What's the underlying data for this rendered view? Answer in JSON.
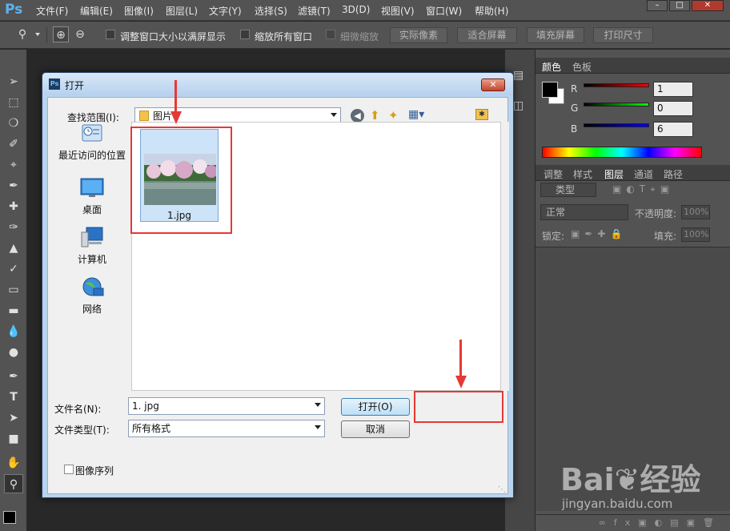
{
  "menubar": {
    "logo": "Ps",
    "items": [
      "文件(F)",
      "编辑(E)",
      "图像(I)",
      "图层(L)",
      "文字(Y)",
      "选择(S)",
      "滤镜(T)",
      "3D(D)",
      "视图(V)",
      "窗口(W)",
      "帮助(H)"
    ],
    "win_min": "–",
    "win_max": "□",
    "win_close": "✕"
  },
  "optionsbar": {
    "resize_windows": "调整窗口大小以满屏显示",
    "zoom_all": "缩放所有窗口",
    "scrubby_zoom": "细微缩放",
    "actual_pixels": "实际像素",
    "fit_screen": "适合屏幕",
    "fill_screen": "填充屏幕",
    "print_size": "打印尺寸"
  },
  "color_panel": {
    "tabs": [
      "颜色",
      "色板"
    ],
    "labels": [
      "R",
      "G",
      "B"
    ],
    "values": [
      "1",
      "0",
      "6"
    ],
    "foreground": "#010006",
    "background": "#ffffff"
  },
  "layers_panel": {
    "tabs": [
      "调整",
      "样式",
      "图层",
      "通道",
      "路径"
    ],
    "filter_kind": "类型",
    "blend_mode": "正常",
    "opacity_label": "不透明度:",
    "opacity_value": "100%",
    "lock_label": "锁定:",
    "fill_label": "填充:",
    "fill_value": "100%"
  },
  "dialog": {
    "title": "打开",
    "look_in_label": "查找范围(I):",
    "look_in_value": "图片",
    "places": [
      {
        "label": "最近访问的位置",
        "icon": "recent-places-icon"
      },
      {
        "label": "桌面",
        "icon": "desktop-icon"
      },
      {
        "label": "计算机",
        "icon": "computer-icon"
      },
      {
        "label": "网络",
        "icon": "network-icon"
      }
    ],
    "file_item": "1.jpg",
    "filename_label": "文件名(N):",
    "filename_value": "1. jpg",
    "filetype_label": "文件类型(T):",
    "filetype_value": "所有格式",
    "open_button": "打开(O)",
    "cancel_button": "取消",
    "image_sequence": "图像序列"
  },
  "watermark": {
    "logo": "Bai❦经验",
    "url": "jingyan.baidu.com"
  }
}
